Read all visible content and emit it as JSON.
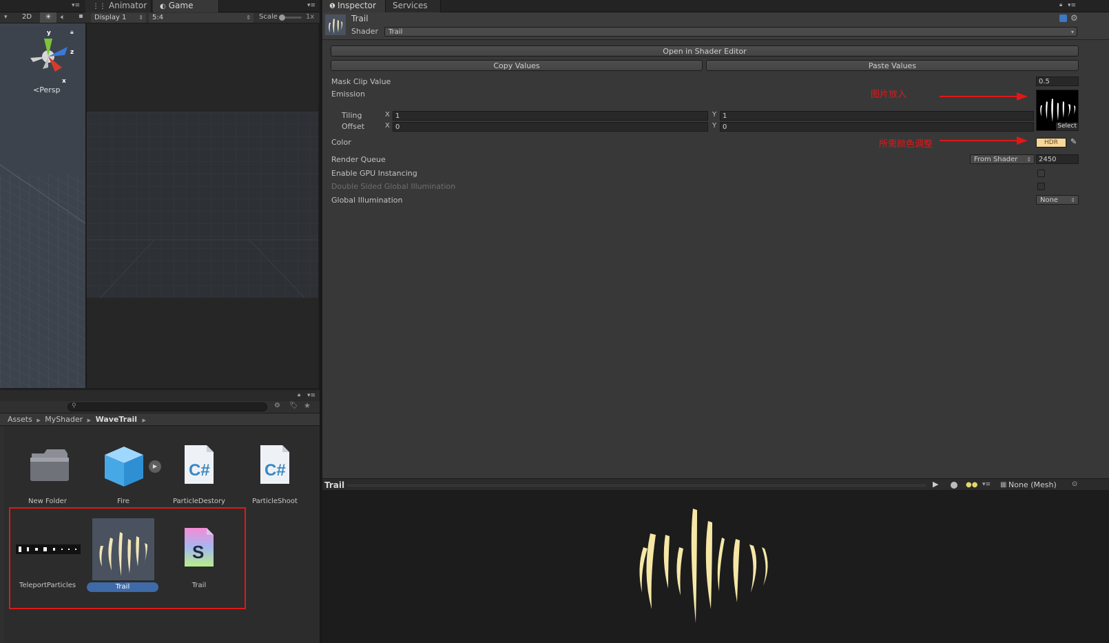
{
  "left_tabs": {
    "animator": "Animator",
    "game": "Game"
  },
  "scene_toolbar": {
    "mode_2d": "2D",
    "gizmo_y": "y",
    "gizmo_z": "z",
    "gizmo_x": "x",
    "persp": "Persp"
  },
  "game_toolbar": {
    "display": "Display 1",
    "aspect": "5:4",
    "scale_label": "Scale",
    "scale_value": "1x"
  },
  "project": {
    "breadcrumb": [
      "Assets",
      "MyShader",
      "WaveTrail"
    ],
    "assets": [
      {
        "label": "New Folder"
      },
      {
        "label": "Fire"
      },
      {
        "label": "ParticleDestory"
      },
      {
        "label": "ParticleShoot"
      },
      {
        "label": "TeleportParticles"
      },
      {
        "label": "Trail"
      },
      {
        "label": "Trail"
      }
    ]
  },
  "inspector": {
    "tabs": {
      "inspector": "Inspector",
      "services": "Services"
    },
    "material_name": "Trail",
    "shader_label": "Shader",
    "shader_value": "Trail",
    "open_editor_button": "Open in Shader Editor",
    "copy_button": "Copy Values",
    "paste_button": "Paste Values",
    "mask_clip_label": "Mask Clip Value",
    "mask_clip_value": "0.5",
    "emission_label": "Emission",
    "tiling_label": "Tiling",
    "offset_label": "Offset",
    "axis_x": "X",
    "axis_y": "Y",
    "tiling_x": "1",
    "tiling_y": "1",
    "offset_x": "0",
    "offset_y": "0",
    "select_label": "Select",
    "color_label": "Color",
    "hdr_label": "HDR",
    "render_queue_label": "Render Queue",
    "render_queue_mode": "From Shader",
    "render_queue_value": "2450",
    "gpu_instancing_label": "Enable GPU Instancing",
    "double_sided_gi_label": "Double Sided Global Illumination",
    "global_illumination_label": "Global Illumination",
    "global_illumination_value": "None",
    "annotation_image": "图片放入",
    "annotation_color": "所需颜色调整"
  },
  "preview": {
    "title": "Trail",
    "mesh": "None (Mesh)"
  },
  "colors": {
    "accent_red": "#e01818",
    "hdr_swatch": "#f7d79a",
    "selection_blue": "#3e6aa8",
    "trail_cream": "#f6e7a6"
  }
}
